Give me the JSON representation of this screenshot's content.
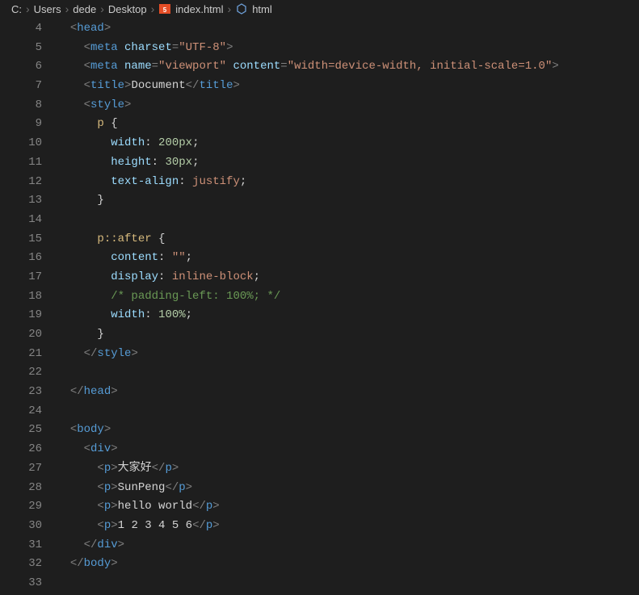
{
  "breadcrumb": {
    "segs": [
      "C:",
      "Users",
      "dede",
      "Desktop",
      "index.html",
      "html"
    ]
  },
  "gutter": {
    "start": 4,
    "end": 33
  },
  "code": [
    {
      "i": "  ",
      "t": [
        [
          "punc",
          "<"
        ],
        [
          "tag",
          "head"
        ],
        [
          "punc",
          ">"
        ]
      ]
    },
    {
      "i": "    ",
      "t": [
        [
          "punc",
          "<"
        ],
        [
          "tag",
          "meta"
        ],
        [
          "text",
          " "
        ],
        [
          "attr",
          "charset"
        ],
        [
          "punc",
          "="
        ],
        [
          "str",
          "\"UTF-8\""
        ],
        [
          "punc",
          ">"
        ]
      ]
    },
    {
      "i": "    ",
      "t": [
        [
          "punc",
          "<"
        ],
        [
          "tag",
          "meta"
        ],
        [
          "text",
          " "
        ],
        [
          "attr",
          "name"
        ],
        [
          "punc",
          "="
        ],
        [
          "str",
          "\"viewport\""
        ],
        [
          "text",
          " "
        ],
        [
          "attr",
          "content"
        ],
        [
          "punc",
          "="
        ],
        [
          "str",
          "\"width=device-width, initial-scale=1.0\""
        ],
        [
          "punc",
          ">"
        ]
      ]
    },
    {
      "i": "    ",
      "t": [
        [
          "punc",
          "<"
        ],
        [
          "tag",
          "title"
        ],
        [
          "punc",
          ">"
        ],
        [
          "text",
          "Document"
        ],
        [
          "punc",
          "</"
        ],
        [
          "tag",
          "title"
        ],
        [
          "punc",
          ">"
        ]
      ]
    },
    {
      "i": "    ",
      "t": [
        [
          "punc",
          "<"
        ],
        [
          "tag",
          "style"
        ],
        [
          "punc",
          ">"
        ]
      ]
    },
    {
      "i": "      ",
      "t": [
        [
          "sel",
          "p"
        ],
        [
          "text",
          " "
        ],
        [
          "brace",
          "{"
        ]
      ]
    },
    {
      "i": "        ",
      "t": [
        [
          "prop",
          "width"
        ],
        [
          "colon",
          ":"
        ],
        [
          "text",
          " "
        ],
        [
          "num",
          "200px"
        ],
        [
          "colon",
          ";"
        ]
      ]
    },
    {
      "i": "        ",
      "t": [
        [
          "prop",
          "height"
        ],
        [
          "colon",
          ":"
        ],
        [
          "text",
          " "
        ],
        [
          "num",
          "30px"
        ],
        [
          "colon",
          ";"
        ]
      ]
    },
    {
      "i": "        ",
      "t": [
        [
          "prop",
          "text-align"
        ],
        [
          "colon",
          ":"
        ],
        [
          "text",
          " "
        ],
        [
          "val",
          "justify"
        ],
        [
          "colon",
          ";"
        ]
      ]
    },
    {
      "i": "      ",
      "t": [
        [
          "brace",
          "}"
        ]
      ]
    },
    {
      "i": "",
      "t": []
    },
    {
      "i": "      ",
      "t": [
        [
          "sel",
          "p::after"
        ],
        [
          "text",
          " "
        ],
        [
          "brace",
          "{"
        ]
      ]
    },
    {
      "i": "        ",
      "t": [
        [
          "prop",
          "content"
        ],
        [
          "colon",
          ":"
        ],
        [
          "text",
          " "
        ],
        [
          "str",
          "\"\""
        ],
        [
          "colon",
          ";"
        ]
      ]
    },
    {
      "i": "        ",
      "t": [
        [
          "prop",
          "display"
        ],
        [
          "colon",
          ":"
        ],
        [
          "text",
          " "
        ],
        [
          "val",
          "inline-block"
        ],
        [
          "colon",
          ";"
        ]
      ]
    },
    {
      "i": "        ",
      "t": [
        [
          "comment",
          "/* padding-left: 100%; */"
        ]
      ]
    },
    {
      "i": "        ",
      "t": [
        [
          "prop",
          "width"
        ],
        [
          "colon",
          ":"
        ],
        [
          "text",
          " "
        ],
        [
          "num",
          "100%"
        ],
        [
          "colon",
          ";"
        ]
      ]
    },
    {
      "i": "      ",
      "t": [
        [
          "brace",
          "}"
        ]
      ]
    },
    {
      "i": "    ",
      "t": [
        [
          "punc",
          "</"
        ],
        [
          "tag",
          "style"
        ],
        [
          "punc",
          ">"
        ]
      ]
    },
    {
      "i": "",
      "t": []
    },
    {
      "i": "  ",
      "t": [
        [
          "punc",
          "</"
        ],
        [
          "tag",
          "head"
        ],
        [
          "punc",
          ">"
        ]
      ]
    },
    {
      "i": "",
      "t": []
    },
    {
      "i": "  ",
      "t": [
        [
          "punc",
          "<"
        ],
        [
          "tag",
          "body"
        ],
        [
          "punc",
          ">"
        ]
      ]
    },
    {
      "i": "    ",
      "t": [
        [
          "punc",
          "<"
        ],
        [
          "tag",
          "div"
        ],
        [
          "punc",
          ">"
        ]
      ]
    },
    {
      "i": "      ",
      "t": [
        [
          "punc",
          "<"
        ],
        [
          "tag",
          "p"
        ],
        [
          "punc",
          ">"
        ],
        [
          "text",
          "大家好"
        ],
        [
          "punc",
          "</"
        ],
        [
          "tag",
          "p"
        ],
        [
          "punc",
          ">"
        ]
      ]
    },
    {
      "i": "      ",
      "t": [
        [
          "punc",
          "<"
        ],
        [
          "tag",
          "p"
        ],
        [
          "punc",
          ">"
        ],
        [
          "text",
          "SunPeng"
        ],
        [
          "punc",
          "</"
        ],
        [
          "tag",
          "p"
        ],
        [
          "punc",
          ">"
        ]
      ]
    },
    {
      "i": "      ",
      "t": [
        [
          "punc",
          "<"
        ],
        [
          "tag",
          "p"
        ],
        [
          "punc",
          ">"
        ],
        [
          "text",
          "hello world"
        ],
        [
          "punc",
          "</"
        ],
        [
          "tag",
          "p"
        ],
        [
          "punc",
          ">"
        ]
      ]
    },
    {
      "i": "      ",
      "t": [
        [
          "punc",
          "<"
        ],
        [
          "tag",
          "p"
        ],
        [
          "punc",
          ">"
        ],
        [
          "text",
          "1 2 3 4 5 6"
        ],
        [
          "punc",
          "</"
        ],
        [
          "tag",
          "p"
        ],
        [
          "punc",
          ">"
        ]
      ]
    },
    {
      "i": "    ",
      "t": [
        [
          "punc",
          "</"
        ],
        [
          "tag",
          "div"
        ],
        [
          "punc",
          ">"
        ]
      ]
    },
    {
      "i": "  ",
      "t": [
        [
          "punc",
          "</"
        ],
        [
          "tag",
          "body"
        ],
        [
          "punc",
          ">"
        ]
      ]
    },
    {
      "i": "",
      "t": []
    }
  ]
}
